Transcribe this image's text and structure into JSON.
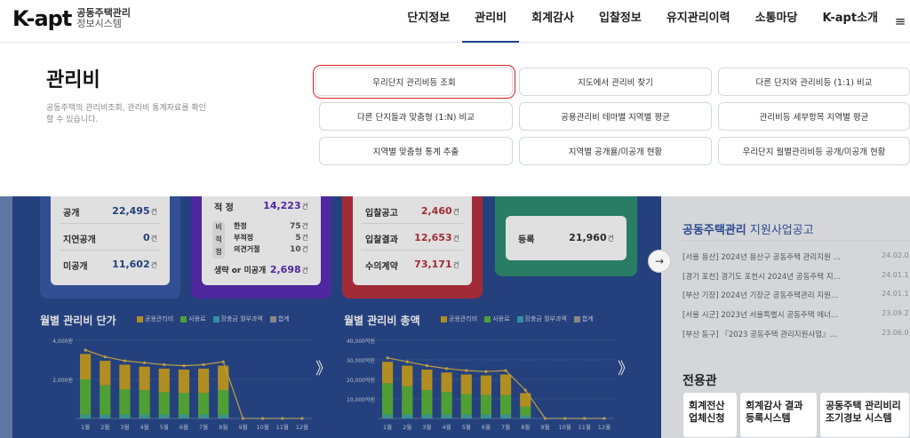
{
  "header": {
    "logo_main": "K-apt",
    "logo_sub1": "공동주택관리",
    "logo_sub2": "정보시스템",
    "nav": [
      "단지정보",
      "관리비",
      "회계감사",
      "입찰정보",
      "유지관리이력",
      "소통마당",
      "K-apt소개"
    ],
    "active_nav": "관리비",
    "menu_icon": "≡"
  },
  "mega": {
    "title": "관리비",
    "description": "공동주택의 관리비조회, 관리비 통계자료를 확인 할 수 있습니다.",
    "buttons": [
      "우리단지 관리비등 조회",
      "지도에서 관리비 찾기",
      "다른 단지와 관리비등 (1:1) 비교",
      "다른 단지들과 맞춤형 (1:N) 비교",
      "공용관리비 테마별 지역별 평균",
      "관리비등 세부항목 지역별 평균",
      "지역별 맞춤형 통계 추출",
      "지역별 공개율/미공개 현황",
      "우리단지 월별관리비등 공개/미공개 현황"
    ],
    "selected_button": "우리단지 관리비등 조회"
  },
  "stats": {
    "disclosure": [
      {
        "label": "공개",
        "value": "22,495",
        "unit": "건"
      },
      {
        "label": "지연공개",
        "value": "0",
        "unit": "건"
      },
      {
        "label": "미공개",
        "value": "11,602",
        "unit": "건"
      }
    ],
    "audit": {
      "appropriate_label": "적 정",
      "appropriate_value": "14,223",
      "unit": "건",
      "inappropriate_tag": "비 적 정",
      "sub": [
        {
          "label": "한정",
          "value": "75",
          "unit": "건"
        },
        {
          "label": "부적정",
          "value": "5",
          "unit": "건"
        },
        {
          "label": "의견거절",
          "value": "10",
          "unit": "건"
        }
      ],
      "omitted_label": "생략 or 미공개",
      "omitted_value": "2,698"
    },
    "bidding": [
      {
        "label": "입찰공고",
        "value": "2,460",
        "unit": "건"
      },
      {
        "label": "입찰결과",
        "value": "12,653",
        "unit": "건"
      },
      {
        "label": "수의계약",
        "value": "73,171",
        "unit": "건"
      }
    ],
    "registration": {
      "label": "등록",
      "value": "21,960",
      "unit": "건"
    }
  },
  "legend": [
    {
      "name": "공용관리비",
      "color": "#c9a227"
    },
    {
      "name": "사용료",
      "color": "#5bb53c"
    },
    {
      "name": "장충금 월부과액",
      "color": "#3aa3b6"
    },
    {
      "name": "합계",
      "color": "#9a9a9a"
    }
  ],
  "chart_data": [
    {
      "type": "bar",
      "title": "월별 관리비 단가",
      "categories": [
        "1월",
        "2월",
        "3월",
        "4월",
        "5월",
        "6월",
        "7월",
        "8월",
        "9월",
        "10월",
        "11월",
        "12월"
      ],
      "yticks": [
        "4,000원",
        "2,000원"
      ],
      "ylim": [
        0,
        4000
      ],
      "series": [
        {
          "name": "공용관리비",
          "values": [
            1300,
            1250,
            1250,
            1200,
            1200,
            1200,
            1250,
            1250,
            0,
            0,
            0,
            0
          ]
        },
        {
          "name": "사용료",
          "values": [
            2000,
            1700,
            1500,
            1450,
            1350,
            1300,
            1300,
            1450,
            0,
            0,
            0,
            0
          ]
        },
        {
          "name": "장충금 월부과액",
          "values": [
            200,
            200,
            200,
            200,
            200,
            200,
            200,
            200,
            0,
            0,
            0,
            0
          ]
        },
        {
          "name": "합계",
          "values": [
            3500,
            3150,
            2950,
            2850,
            2750,
            2700,
            2750,
            2900,
            0,
            0,
            0,
            0
          ]
        }
      ]
    },
    {
      "type": "bar",
      "title": "월별 관리비 총액",
      "categories": [
        "1월",
        "2월",
        "3월",
        "4월",
        "5월",
        "6월",
        "7월",
        "8월",
        "9월",
        "10월",
        "11월",
        "12월"
      ],
      "yticks": [
        "40,000억원",
        "30,000억원",
        "20,000억원",
        "10,000억원"
      ],
      "ylim": [
        0,
        40000
      ],
      "series": [
        {
          "name": "공용관리비",
          "values": [
            11000,
            10500,
            10500,
            10000,
            10000,
            10000,
            10500,
            7000,
            0,
            0,
            0,
            0
          ]
        },
        {
          "name": "사용료",
          "values": [
            18000,
            16500,
            14500,
            13500,
            12500,
            12000,
            12000,
            6000,
            0,
            0,
            0,
            0
          ]
        },
        {
          "name": "장충금 월부과액",
          "values": [
            2000,
            2000,
            2000,
            2000,
            2000,
            2000,
            2000,
            1500,
            0,
            0,
            0,
            0
          ]
        },
        {
          "name": "합계",
          "values": [
            31000,
            29000,
            27000,
            25500,
            24500,
            24000,
            24500,
            14500,
            0,
            0,
            0,
            0
          ]
        }
      ]
    }
  ],
  "next_arrow": "→",
  "chevron": "》",
  "notice": {
    "title_bold": "공동주택관리",
    "title_rest": " 지원사업공고",
    "items": [
      {
        "text": "[서울 용산] 2024년 용산구 공동주택 관리지원 …",
        "date": "24.02.0"
      },
      {
        "text": "[경기 포천] 경기도 포천시 2024년 공동주택 지…",
        "date": "24.01.1"
      },
      {
        "text": "[부산 기장] 2024년 기장군 공동주택관리 지원…",
        "date": "24.01.1"
      },
      {
        "text": "[서울 시군] 2023년 서울특별시 공동주택 에너…",
        "date": "23.09.2"
      },
      {
        "text": "[부산 동구] 『2023 공동주택 관리지원사업』…",
        "date": "23.06.0"
      }
    ]
  },
  "dedicated": {
    "title": "전용관",
    "buttons": [
      "회계전산 업체신청",
      "회계감사 결과 등록시스템",
      "공동주택 관리비리 조기경보 시스템"
    ]
  }
}
